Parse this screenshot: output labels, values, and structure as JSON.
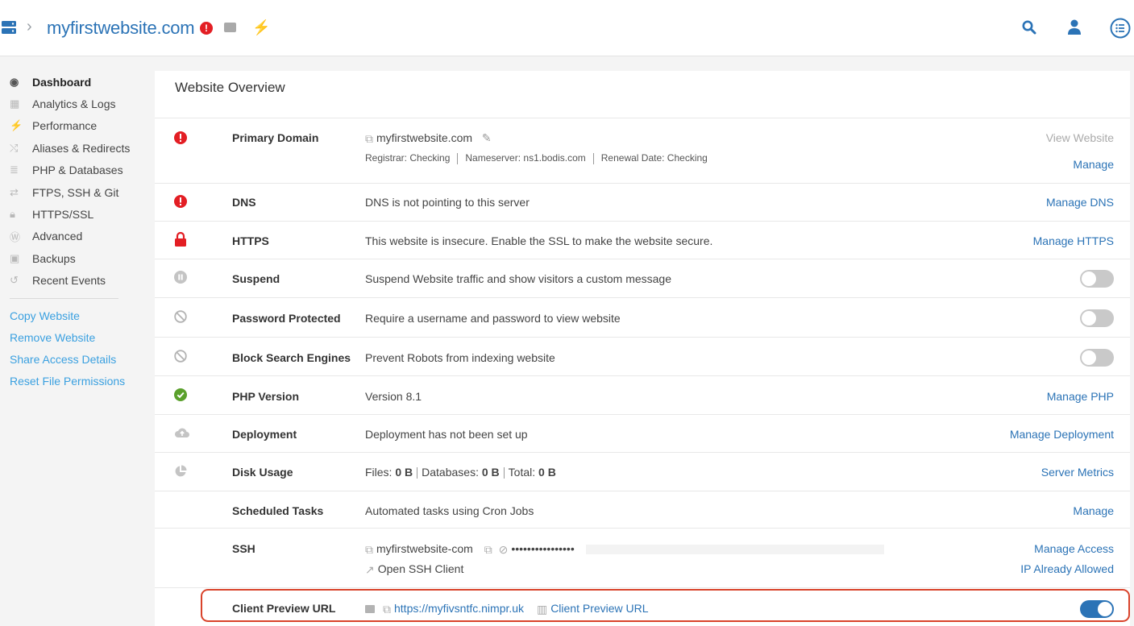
{
  "header": {
    "site_title": "myfirstwebsite.com",
    "warn_badge": "!"
  },
  "sidebar": {
    "items": [
      {
        "label": "Dashboard",
        "icon": "dashboard-icon",
        "active": true
      },
      {
        "label": "Analytics & Logs",
        "icon": "chart-icon"
      },
      {
        "label": "Performance",
        "icon": "bolt-icon"
      },
      {
        "label": "Aliases & Redirects",
        "icon": "shuffle-icon"
      },
      {
        "label": "PHP & Databases",
        "icon": "database-icon"
      },
      {
        "label": "FTPS, SSH & Git",
        "icon": "exchange-icon"
      },
      {
        "label": "HTTPS/SSL",
        "icon": "lock-icon"
      },
      {
        "label": "Advanced",
        "icon": "advanced-icon"
      },
      {
        "label": "Backups",
        "icon": "camera-icon"
      },
      {
        "label": "Recent Events",
        "icon": "history-icon"
      }
    ],
    "actions": [
      "Copy Website",
      "Remove Website",
      "Share Access Details",
      "Reset File Permissions"
    ]
  },
  "overview": {
    "title": "Website Overview",
    "primary_domain": {
      "label": "Primary Domain",
      "domain": "myfirstwebsite.com",
      "registrar": "Registrar: Checking",
      "nameserver": "Nameserver: ns1.bodis.com",
      "renewal": "Renewal Date: Checking",
      "view_link": "View Website",
      "manage_link": "Manage"
    },
    "dns": {
      "label": "DNS",
      "desc": "DNS is not pointing to this server",
      "link": "Manage DNS"
    },
    "https": {
      "label": "HTTPS",
      "desc": "This website is insecure. Enable the SSL to make the website secure.",
      "link": "Manage HTTPS"
    },
    "suspend": {
      "label": "Suspend",
      "desc": "Suspend Website traffic and show visitors a custom message"
    },
    "password": {
      "label": "Password Protected",
      "desc": "Require a username and password to view website"
    },
    "block": {
      "label": "Block Search Engines",
      "desc": "Prevent Robots from indexing website"
    },
    "php": {
      "label": "PHP Version",
      "desc": "Version 8.1",
      "link": "Manage PHP"
    },
    "deployment": {
      "label": "Deployment",
      "desc": "Deployment has not been set up",
      "link": "Manage Deployment"
    },
    "disk": {
      "label": "Disk Usage",
      "files_label": "Files:",
      "files_value": "0 B",
      "db_label": "Databases:",
      "db_value": "0 B",
      "total_label": "Total:",
      "total_value": "0 B",
      "link": "Server Metrics"
    },
    "tasks": {
      "label": "Scheduled Tasks",
      "desc": "Automated tasks using Cron Jobs",
      "link": "Manage"
    },
    "ssh": {
      "label": "SSH",
      "username": "myfirstwebsite-com",
      "password_mask": "••••••••••••••••",
      "open_client": "Open SSH Client",
      "manage_link": "Manage Access",
      "ip_link": "IP Already Allowed"
    },
    "preview": {
      "label": "Client Preview URL",
      "url": "https://myfivsntfc.nimpr.uk",
      "doc_link": "Client Preview URL"
    }
  },
  "toggles": {
    "suspend": false,
    "password": false,
    "block": false,
    "preview": true
  },
  "colors": {
    "accent": "#2b73b6",
    "danger": "#e31e24",
    "success": "#5aa02c",
    "action_link": "#3aa0e0"
  }
}
